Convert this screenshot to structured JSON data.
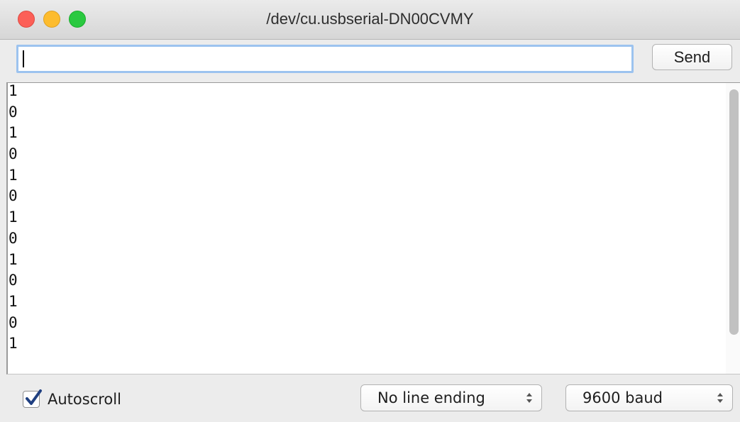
{
  "window": {
    "title": "/dev/cu.usbserial-DN00CVMY"
  },
  "toolbar": {
    "input_value": "",
    "send_label": "Send"
  },
  "output": {
    "lines": [
      "1",
      "0",
      "1",
      "0",
      "1",
      "0",
      "1",
      "0",
      "1",
      "0",
      "1",
      "0",
      "1"
    ]
  },
  "bottombar": {
    "autoscroll_label": "Autoscroll",
    "autoscroll_checked": true,
    "line_ending_value": "No line ending",
    "baud_value": "9600 baud"
  },
  "colors": {
    "close": "#fc5f57",
    "minimize": "#fdbc2e",
    "maximize": "#2ac940",
    "focus_ring": "#9cc3ef",
    "checkbox_accent": "#1f3f80"
  },
  "icons": {
    "close": "close-traffic-light-icon",
    "minimize": "minimize-traffic-light-icon",
    "maximize": "maximize-traffic-light-icon",
    "checkmark": "checkmark-icon",
    "stepper": "up-down-stepper-icon"
  }
}
